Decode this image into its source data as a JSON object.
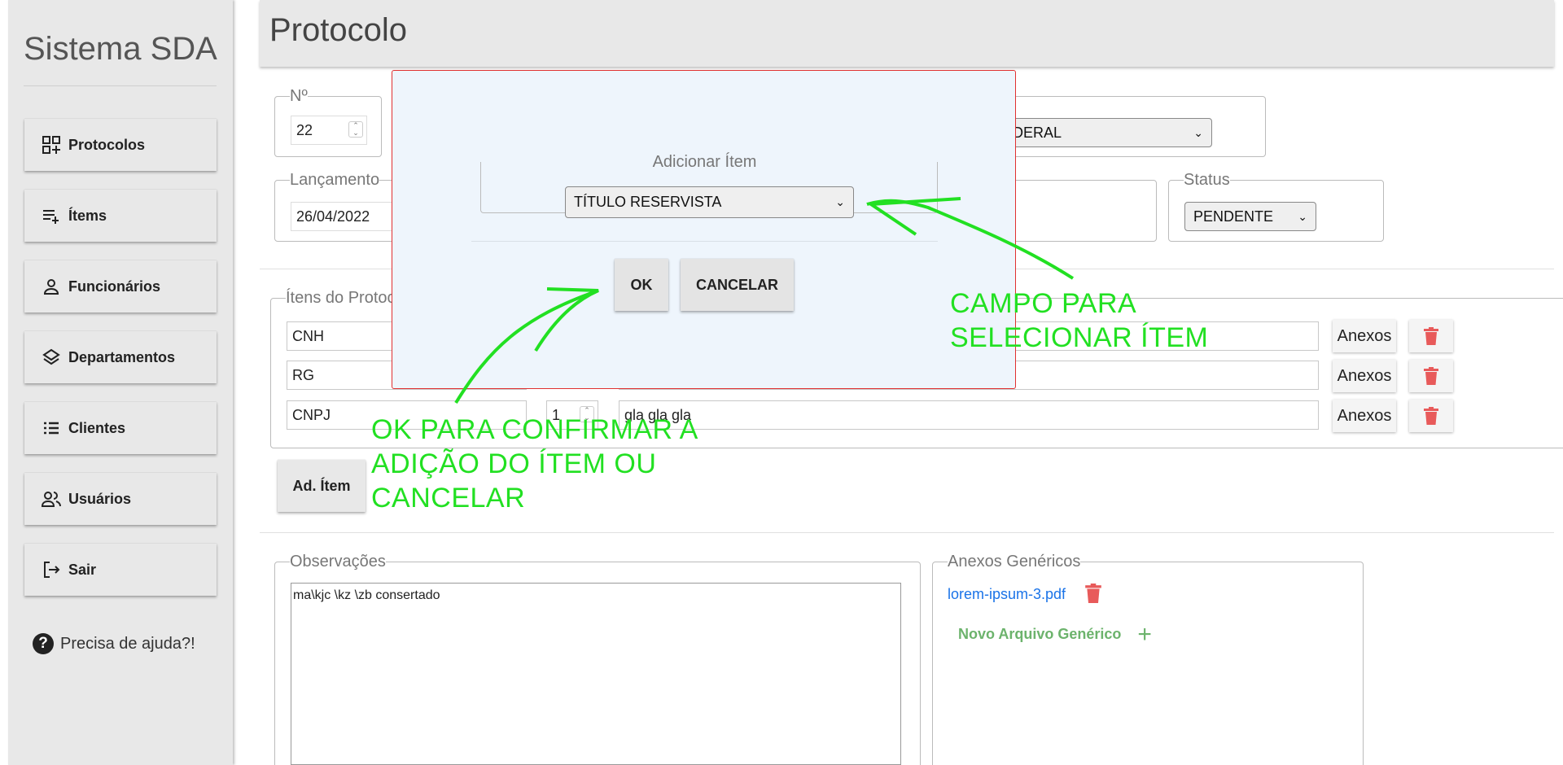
{
  "sidebar": {
    "brand": "Sistema SDA",
    "items": [
      {
        "label": "Protocolos",
        "icon": "protocols-icon"
      },
      {
        "label": "Ítems",
        "icon": "playlist-add-icon"
      },
      {
        "label": "Funcionários",
        "icon": "person-icon"
      },
      {
        "label": "Departamentos",
        "icon": "layers-icon"
      },
      {
        "label": "Clientes",
        "icon": "list-icon"
      },
      {
        "label": "Usuários",
        "icon": "group-icon"
      },
      {
        "label": "Sair",
        "icon": "logout-icon"
      }
    ],
    "help": "Precisa de ajuda?!"
  },
  "header": {
    "title": "Protocolo"
  },
  "form": {
    "numero": {
      "label": "Nº",
      "value": "22"
    },
    "tipo": {
      "value": "EDERAL"
    },
    "lancamento": {
      "label": "Lançamento",
      "value": "26/04/2022"
    },
    "status": {
      "label": "Status",
      "value": "PENDENTE"
    }
  },
  "items_section": {
    "legend": "Ítens do Protoco",
    "rows": [
      {
        "name": "CNH",
        "qty": "",
        "desc": "",
        "attach_label": "Anexos"
      },
      {
        "name": "RG",
        "qty": "",
        "desc": "",
        "attach_label": "Anexos"
      },
      {
        "name": "CNPJ",
        "qty": "1",
        "desc": "gla gla gla",
        "attach_label": "Anexos"
      }
    ],
    "add_button": "Ad. Ítem"
  },
  "observacoes": {
    "label": "Observações",
    "value": "ma\\kjc \\kz \\zb  consertado"
  },
  "anexos": {
    "label": "Anexos Genéricos",
    "files": [
      "lorem-ipsum-3.pdf"
    ],
    "new_file": "Novo Arquivo Genérico"
  },
  "modal": {
    "legend": "Adicionar Ítem",
    "select_value": "TÍTULO RESERVISTA",
    "ok": "OK",
    "cancel": "CANCELAR"
  },
  "annotations": {
    "select_note_1": "CAMPO PARA",
    "select_note_2": "SELECIONAR ÍTEM",
    "ok_note_1": "OK PARA CONFIRMAR A",
    "ok_note_2": "ADIÇÃO DO ÍTEM OU",
    "ok_note_3": "CANCELAR"
  },
  "colors": {
    "annotation": "#22e022",
    "modal_border": "#e03030",
    "trash": "#e85a5a",
    "link": "#1a73e8",
    "new_file": "#6cb36c"
  }
}
